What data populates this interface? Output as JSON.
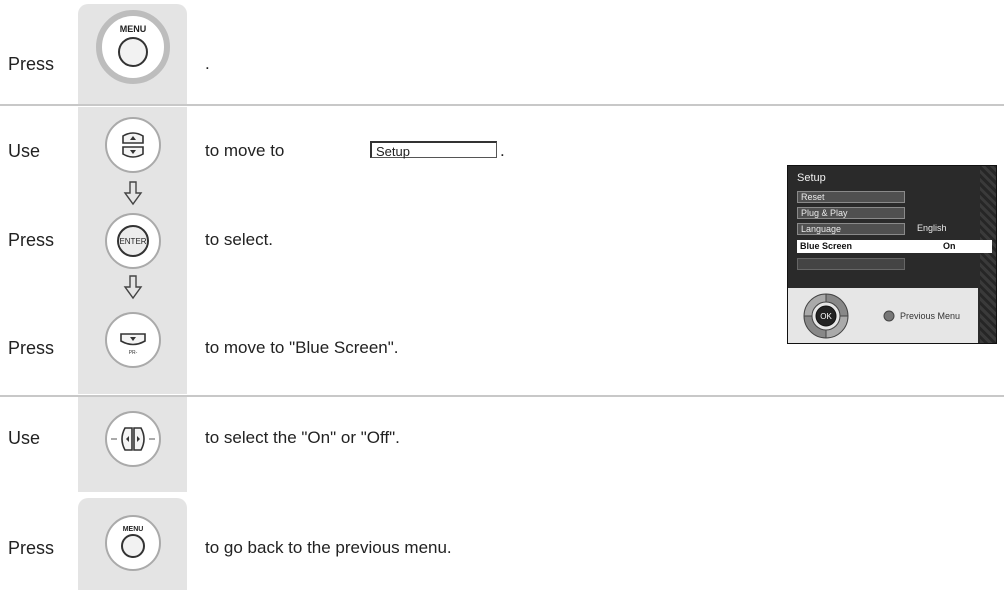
{
  "rows": [
    {
      "verb": "Press",
      "button": "MENU",
      "desc": "."
    },
    {
      "verb": "Use",
      "button": "PR up/down",
      "desc": "to move to",
      "inline_box": "Setup",
      "desc_suffix": "."
    },
    {
      "verb": "Press",
      "button": "ENTER",
      "desc": "to select."
    },
    {
      "verb": "Press",
      "button": "PR down",
      "desc": "to move to \"Blue Screen\"."
    },
    {
      "verb": "Use",
      "button": "VOL left/right",
      "desc": "to select the \"On\" or \"Off\"."
    },
    {
      "verb": "Press",
      "button": "MENU",
      "desc": "to go back to the previous menu."
    }
  ],
  "button_labels": {
    "menu": "MENU",
    "enter": "ENTER",
    "ok": "OK",
    "pr_minus": "PR-"
  },
  "osd": {
    "title": "Setup",
    "items": [
      {
        "label": "Reset",
        "value": ""
      },
      {
        "label": "Plug & Play",
        "value": ""
      },
      {
        "label": "Language",
        "value": "English"
      },
      {
        "label": "Blue Screen",
        "value": "On"
      }
    ],
    "footer": "Previous Menu"
  },
  "colors": {
    "panel": "#e4e4e4",
    "rule": "#c8c8c8",
    "osd_bg": "#2a2a2a",
    "highlight": "#ffffff"
  }
}
